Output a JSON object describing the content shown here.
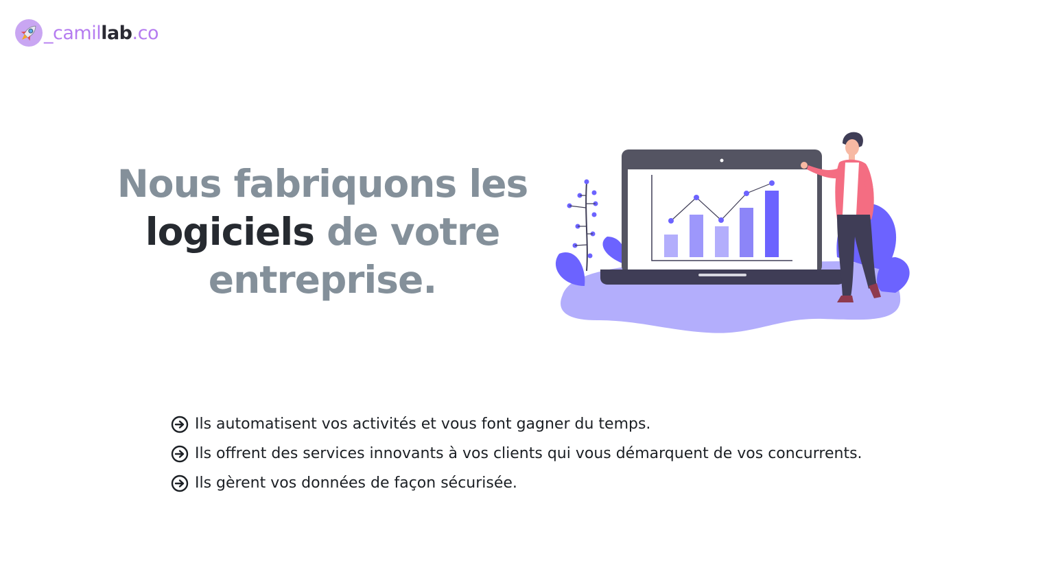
{
  "brand": {
    "part1": "_camil",
    "part2": "lab",
    "part3": ".co",
    "icon": "rocket-icon",
    "colors": {
      "accent": "#b57cf0",
      "dark": "#2a2a33"
    }
  },
  "hero": {
    "line1": "Nous fabriquons les",
    "line2_strong": "logiciels",
    "line2_rest": " de votre",
    "line3": "entreprise."
  },
  "features": [
    {
      "icon": "arrow-right-circle-icon",
      "text": "Ils automatisent vos activités et vous font gagner du temps."
    },
    {
      "icon": "arrow-right-circle-icon",
      "text": "Ils offrent des services innovants à vos clients qui vous démarquent de vos concurrents."
    },
    {
      "icon": "arrow-right-circle-icon",
      "text": "Ils gèrent vos données de façon sécurisée."
    }
  ],
  "colors": {
    "heading_gray": "#84909a",
    "heading_dark": "#262a30",
    "illustration_purple": "#6c63ff",
    "illustration_light": "#b3aefc",
    "person_shirt": "#f46d82"
  }
}
